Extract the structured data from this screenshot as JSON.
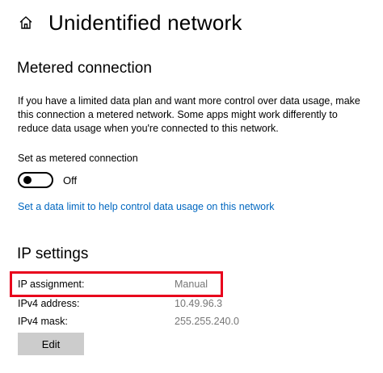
{
  "header": {
    "title": "Unidentified network",
    "home_icon": "home-icon"
  },
  "metered": {
    "section_title": "Metered connection",
    "description": "If you have a limited data plan and want more control over data usage, make this connection a metered network. Some apps might work differently to reduce data usage when you're connected to this network.",
    "toggle_label": "Set as metered connection",
    "toggle_state": "Off",
    "toggle_on": false,
    "data_limit_link": "Set a data limit to help control data usage on this network"
  },
  "ip_settings": {
    "section_title": "IP settings",
    "rows": [
      {
        "label": "IP assignment:",
        "value": "Manual"
      },
      {
        "label": "IPv4 address:",
        "value": "10.49.96.3"
      },
      {
        "label": "IPv4 mask:",
        "value": "255.255.240.0"
      }
    ],
    "edit_label": "Edit"
  },
  "colors": {
    "link": "#0067c0",
    "highlight": "#e8001c",
    "button_bg": "#cccccc",
    "value_text": "#767676"
  }
}
